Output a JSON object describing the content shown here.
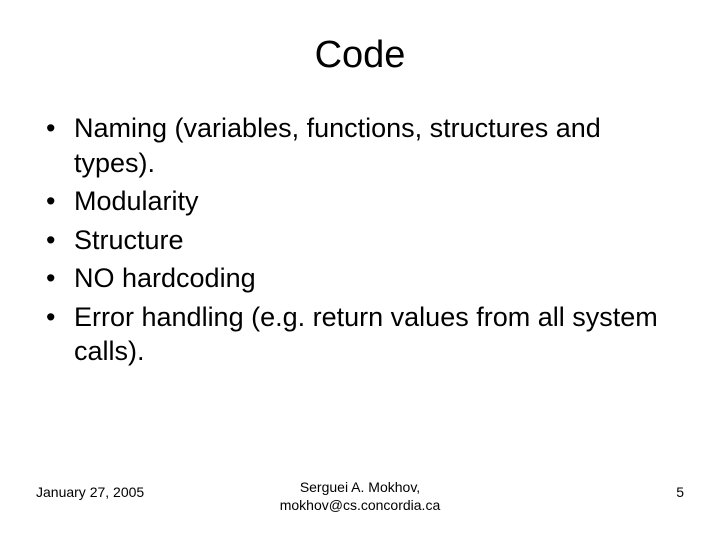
{
  "title": "Code",
  "bullets": [
    "Naming (variables, functions, structures and types).",
    "Modularity",
    "Structure",
    "NO hardcoding",
    "Error handling (e.g. return values from all system calls)."
  ],
  "footer": {
    "date": "January 27, 2005",
    "author_line1": "Serguei A. Mokhov,",
    "author_line2": "mokhov@cs.concordia.ca",
    "page": "5"
  }
}
